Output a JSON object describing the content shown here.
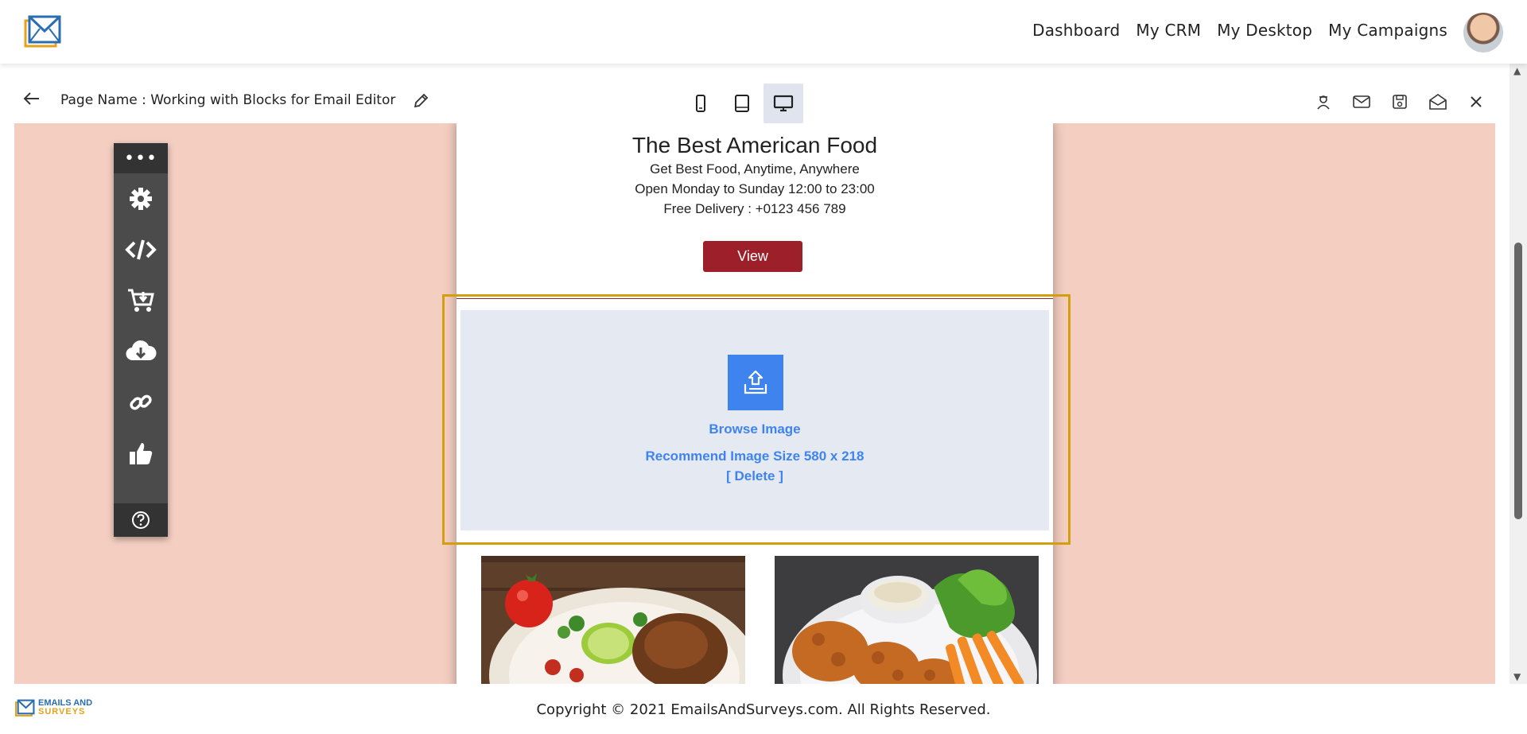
{
  "nav": {
    "items": [
      "Dashboard",
      "My CRM",
      "My Desktop",
      "My Campaigns"
    ]
  },
  "toolbar": {
    "page_name": "Page Name : Working with Blocks for Email Editor"
  },
  "email": {
    "title": "The Best American Food",
    "line1": "Get Best Food, Anytime, Anywhere",
    "line2": "Open Monday to Sunday 12:00 to 23:00",
    "line3": "Free Delivery : +0123 456 789",
    "view_label": "View",
    "browse_label": "Browse Image",
    "recommend_text": "Recommend Image Size 580 x 218",
    "delete_label": "[ Delete ]"
  },
  "footer": {
    "logo_word1": "EMAILS AND",
    "logo_word2": "SURVEYS",
    "copyright": "Copyright © 2021 EmailsAndSurveys.com. All Rights Reserved."
  },
  "colors": {
    "canvas_bg": "#f4cec1",
    "brand_red": "#9d1f2a",
    "selection": "#d39f0f",
    "accent_blue": "#3f84ee",
    "tool_panel": "#4b4b4b"
  },
  "icons": [
    "envelope-logo-icon",
    "back-arrow-icon",
    "pencil-icon",
    "mobile-icon",
    "tablet-icon",
    "desktop-icon",
    "spy-icon",
    "mail-icon",
    "save-icon",
    "open-mail-icon",
    "close-icon",
    "more-icon",
    "gear-icon",
    "code-icon",
    "cart-download-icon",
    "cloud-download-icon",
    "link-icon",
    "thumbs-up-icon",
    "help-icon",
    "upload-icon"
  ]
}
